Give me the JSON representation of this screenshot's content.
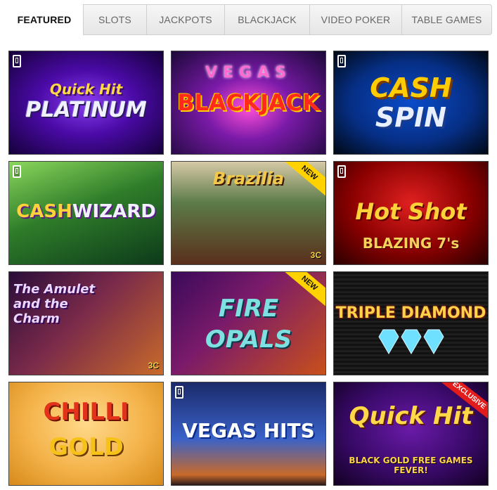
{
  "tabs": [
    {
      "label": "FEATURED",
      "active": true
    },
    {
      "label": "SLOTS",
      "active": false
    },
    {
      "label": "JACKPOTS",
      "active": false
    },
    {
      "label": "BLACKJACK",
      "active": false
    },
    {
      "label": "VIDEO POKER",
      "active": false
    },
    {
      "label": "TABLE GAMES",
      "active": false
    }
  ],
  "games": [
    {
      "line1": "Quick Hit",
      "line2": "PLATINUM",
      "mobile": true
    },
    {
      "line1": "VEGAS",
      "line2": "BLACKJACK",
      "mobile": false
    },
    {
      "line1": "CASH",
      "line2": "SPIN",
      "mobile": true
    },
    {
      "line1": "CASH",
      "line2": "WIZARD",
      "mobile": true
    },
    {
      "line1": "Brazilia",
      "line2": "",
      "badge": "NEW",
      "maker": "3C"
    },
    {
      "line1": "Hot Shot",
      "line2": "BLAZING 7's",
      "mobile": true
    },
    {
      "line1": "The Amulet and the Charm",
      "line2": "",
      "maker": "3C"
    },
    {
      "line1": "FIRE",
      "line2": "OPALS",
      "badge": "NEW"
    },
    {
      "line1": "TRIPLE DIAMOND",
      "line2": ""
    },
    {
      "line1": "CHILLI",
      "line2": "GOLD"
    },
    {
      "line1": "VEGAS HITS",
      "line2": "",
      "mobile": true
    },
    {
      "line1": "Quick Hit",
      "line2": "BLACK GOLD FREE GAMES FEVER!",
      "badge": "EXCLUSIVE"
    }
  ]
}
